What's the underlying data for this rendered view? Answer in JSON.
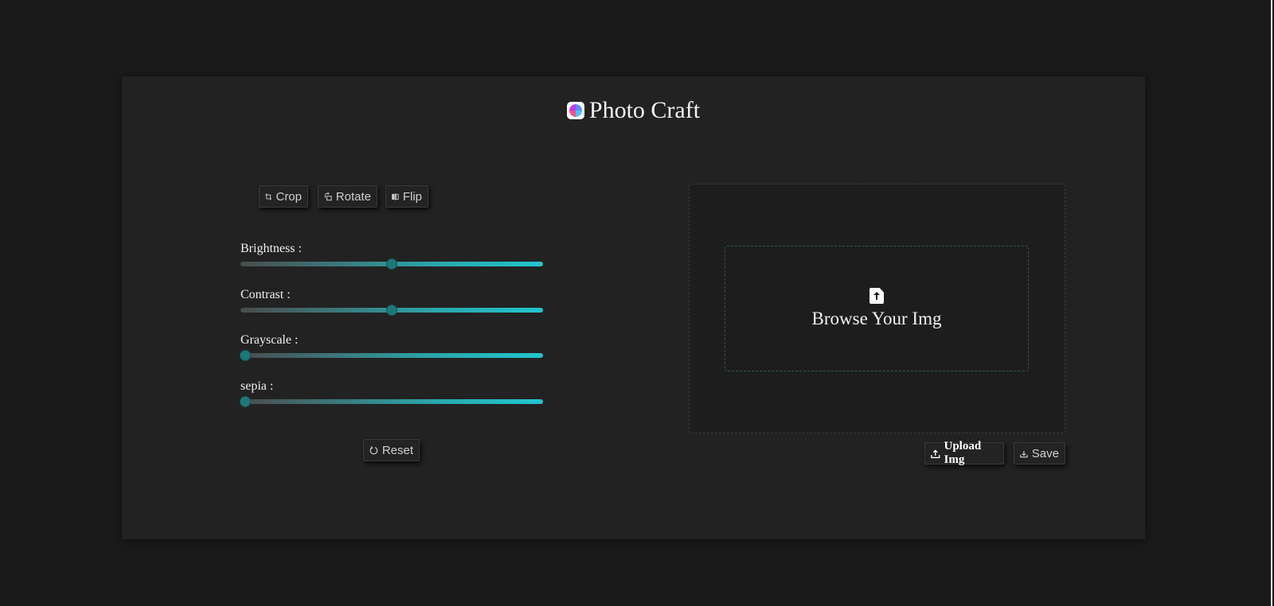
{
  "app": {
    "title": "Photo Craft"
  },
  "toolbar": {
    "crop_label": "Crop",
    "rotate_label": "Rotate",
    "flip_label": "Flip",
    "reset_label": "Reset"
  },
  "filters": [
    {
      "label": "Brightness :",
      "value": 0.5
    },
    {
      "label": "Contrast :",
      "value": 0.5
    },
    {
      "label": "Grayscale :",
      "value": 0.0
    },
    {
      "label": "sepia :",
      "value": 0.0
    }
  ],
  "dropzone": {
    "text": "Browse Your Img"
  },
  "actions": {
    "upload_label": "Upload Img",
    "save_label": "Save"
  },
  "icons": {
    "crop": "crop-icon",
    "rotate": "rotate-icon",
    "flip": "flip-icon",
    "reset": "reset-icon",
    "upload": "upload-icon",
    "save": "download-icon",
    "file_upload": "file-upload-icon"
  },
  "colors": {
    "background": "#1a1a1a",
    "card": "#222222",
    "accent": "#21c6cf",
    "thumb": "#1f7878"
  }
}
